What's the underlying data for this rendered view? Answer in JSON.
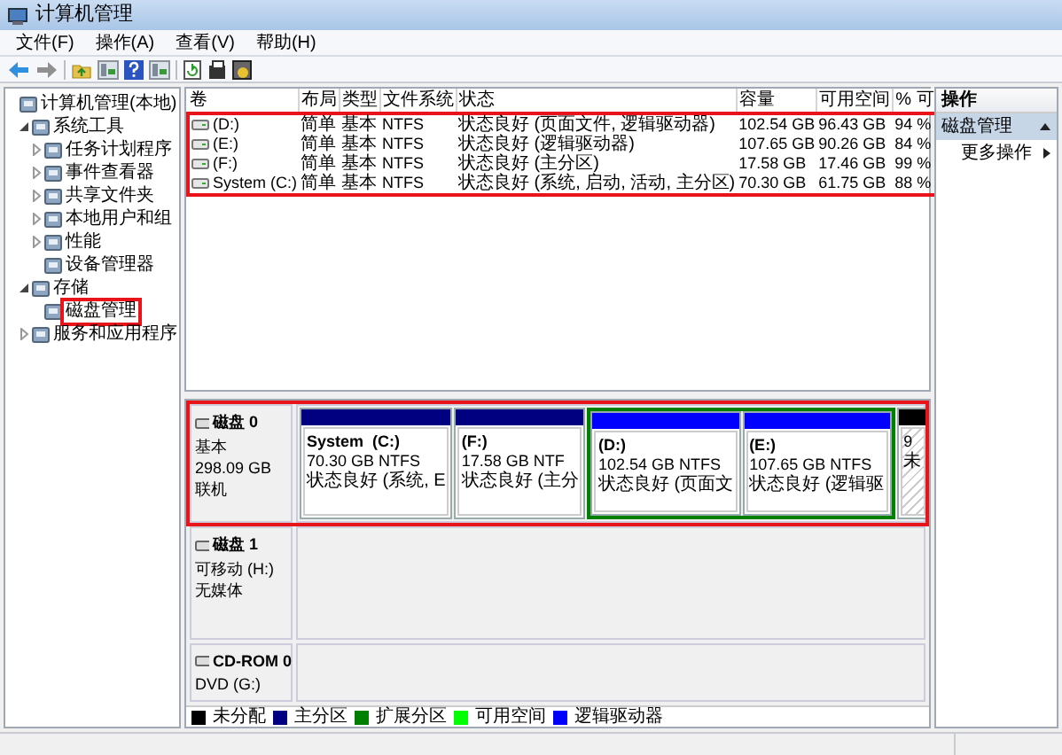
{
  "window": {
    "title": "计算机管理"
  },
  "menu": [
    "文件(F)",
    "操作(A)",
    "查看(V)",
    "帮助(H)"
  ],
  "tree": [
    {
      "label": "计算机管理(本地)",
      "annotated": false,
      "children": [
        {
          "label": "系统工具",
          "expanded": true,
          "annotated": false,
          "children": [
            {
              "label": "任务计划程序",
              "expanded": false,
              "annotated": false
            },
            {
              "label": "事件查看器",
              "expanded": false,
              "annotated": false
            },
            {
              "label": "共享文件夹",
              "expanded": false,
              "annotated": false
            },
            {
              "label": "本地用户和组",
              "expanded": false,
              "annotated": false
            },
            {
              "label": "性能",
              "expanded": false,
              "annotated": false
            },
            {
              "label": "设备管理器",
              "annotated": false
            }
          ]
        },
        {
          "label": "存储",
          "expanded": true,
          "annotated": false,
          "children": [
            {
              "label": "磁盘管理",
              "annotated": true
            }
          ]
        },
        {
          "label": "服务和应用程序",
          "expanded": false,
          "annotated": false
        }
      ]
    }
  ],
  "table": {
    "columns": [
      "卷",
      "布局",
      "类型",
      "文件系统",
      "状态",
      "容量",
      "可用空间",
      "% 可"
    ],
    "annotated": true,
    "rows": [
      [
        "(D:)",
        "简单",
        "基本",
        "NTFS",
        "状态良好 (页面文件, 逻辑驱动器)",
        "102.54 GB",
        "96.43 GB",
        "94 %"
      ],
      [
        "(E:)",
        "简单",
        "基本",
        "NTFS",
        "状态良好 (逻辑驱动器)",
        "107.65 GB",
        "90.26 GB",
        "84 %"
      ],
      [
        "(F:)",
        "简单",
        "基本",
        "NTFS",
        "状态良好 (主分区)",
        "17.58 GB",
        "17.46 GB",
        "99 %"
      ],
      [
        "System (C:)",
        "简单",
        "基本",
        "NTFS",
        "状态良好 (系统, 启动, 活动, 主分区)",
        "70.30 GB",
        "61.75 GB",
        "88 %"
      ]
    ]
  },
  "disks": [
    {
      "name": "磁盘 0",
      "lines": [
        "基本",
        "298.09 GB",
        "联机"
      ],
      "annotated": true,
      "partitions": [
        {
          "kind": "primary",
          "name": "System  (C:)",
          "size": "70.30 GB NTFS",
          "status": "状态良好 (系统, E"
        },
        {
          "kind": "primary",
          "name": "(F:)",
          "size": "17.58 GB NTF",
          "status": "状态良好 (主分"
        },
        {
          "kind": "extended",
          "partitions": [
            {
              "kind": "logical",
              "name": "(D:)",
              "size": "102.54 GB NTFS",
              "status": "状态良好 (页面文"
            },
            {
              "kind": "logical",
              "name": "(E:)",
              "size": "107.65 GB NTFS",
              "status": "状态良好 (逻辑驱"
            }
          ]
        },
        {
          "kind": "unallocated",
          "size": "9",
          "status": "未"
        }
      ]
    },
    {
      "name": "磁盘 1",
      "lines": [
        "可移动 (H:)",
        "无媒体"
      ],
      "annotated": false
    },
    {
      "name": "CD-ROM 0",
      "lines": [
        "DVD (G:)"
      ],
      "annotated": false
    }
  ],
  "legend": [
    {
      "label": "未分配",
      "color": "#000000"
    },
    {
      "label": "主分区",
      "color": "#000080"
    },
    {
      "label": "扩展分区",
      "color": "#008000"
    },
    {
      "label": "可用空间",
      "color": "#00ff00"
    },
    {
      "label": "逻辑驱动器",
      "color": "#0000ff"
    }
  ],
  "actions": {
    "header": "操作",
    "section": "磁盘管理",
    "items": [
      "更多操作"
    ]
  }
}
